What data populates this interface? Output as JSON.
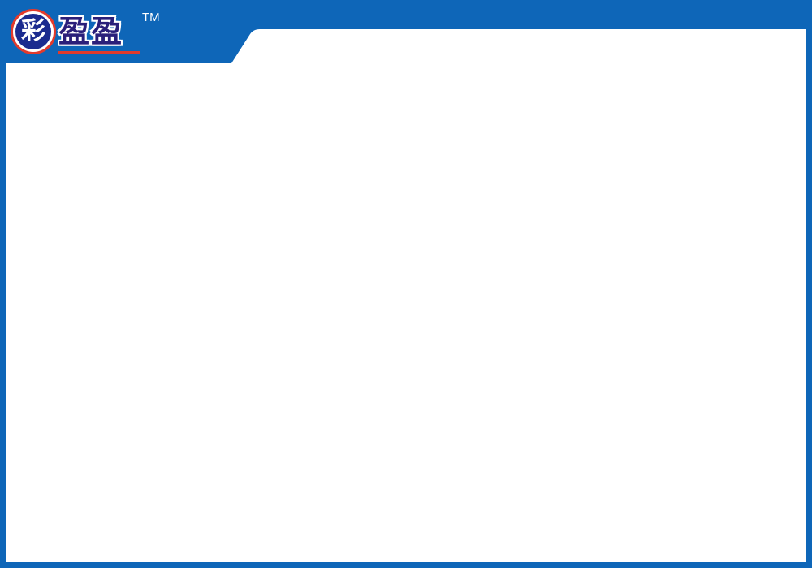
{
  "logo": {
    "emblem_char": "彩",
    "wordmark": "盈盈",
    "trademark": "TM"
  },
  "colors": {
    "frame_blue": "#0e66b8",
    "panel_white": "#ffffff",
    "logo_navy": "#1b2b8f",
    "logo_red": "#e23a2c"
  }
}
